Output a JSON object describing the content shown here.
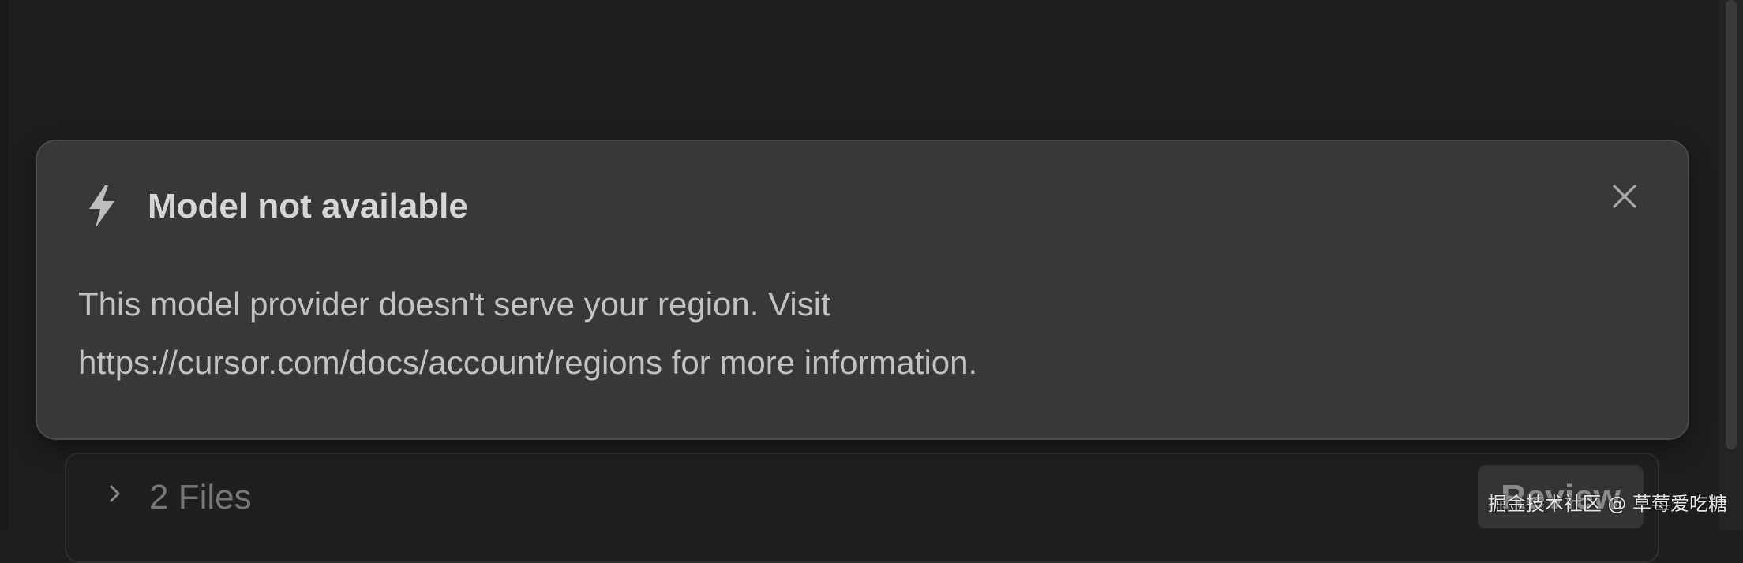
{
  "toast": {
    "icon": "lightning-bolt-icon",
    "title": "Model not available",
    "message_line1": "This model provider doesn't serve your region. Visit",
    "message_line2": "https://cursor.com/docs/account/regions for more information.",
    "close_icon": "close-icon"
  },
  "files_panel": {
    "chevron_icon": "chevron-right-icon",
    "label": "2 Files",
    "review_label": "Review"
  },
  "watermark": {
    "text": "掘金技术社区 @ 草莓爱吃糖"
  },
  "colors": {
    "background": "#1e1e1e",
    "toast_background": "#383838",
    "title_text": "#d6d6d6",
    "body_text": "#c2c2c2"
  }
}
